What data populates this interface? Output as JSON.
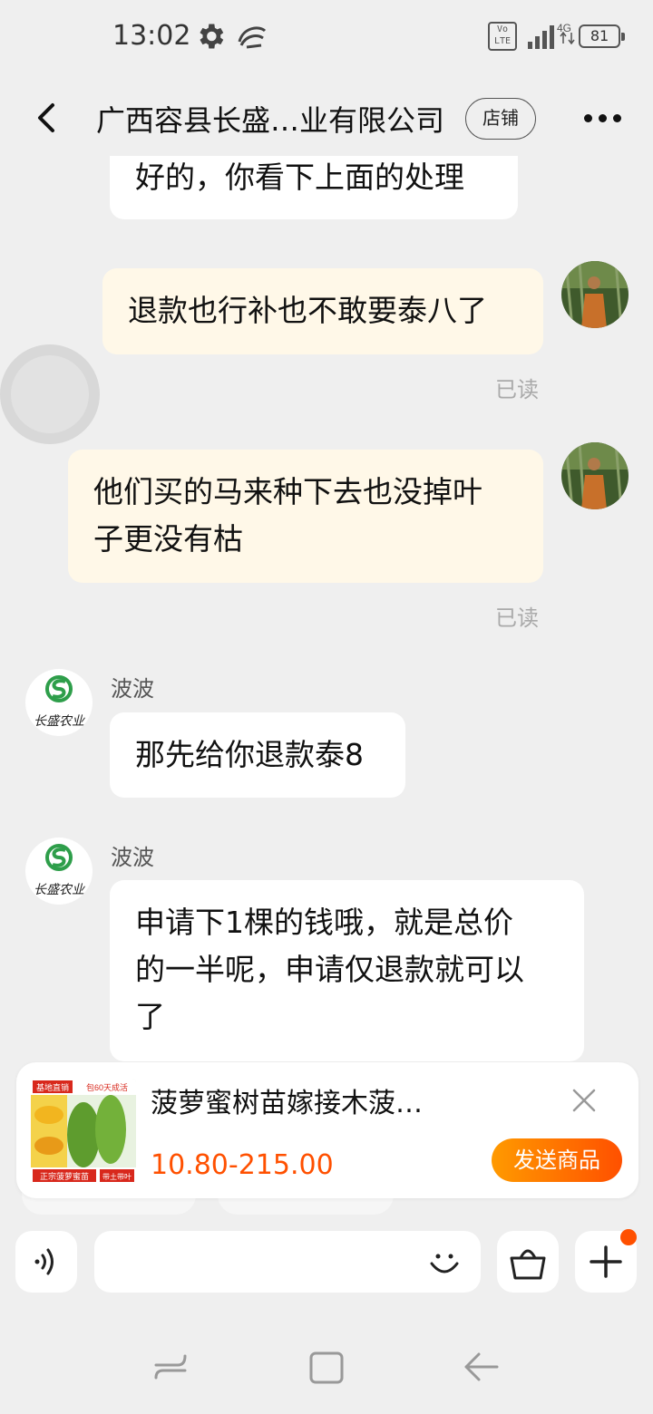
{
  "status_bar": {
    "time": "13:02",
    "network": "4G",
    "volte": "Vo LTE",
    "battery": "81",
    "icons": [
      "gear-icon",
      "app-notification-icon",
      "signal-icon",
      "battery-icon"
    ]
  },
  "header": {
    "title": "广西容县长盛…业有限公司",
    "shop_button": "店铺",
    "icons": [
      "back-icon",
      "more-icon"
    ]
  },
  "messages": {
    "m1": {
      "side": "received",
      "lines": [
        "好的，你看下上面的处理"
      ]
    },
    "m2": {
      "side": "sent",
      "lines": [
        "退款也行补也不敢要泰八了"
      ],
      "status": "已读"
    },
    "m3": {
      "side": "sent",
      "lines": [
        "他们买的马来种下去也没掉叶",
        "子更没有枯"
      ],
      "status": "已读"
    },
    "m4": {
      "side": "received",
      "sender": "波波",
      "lines": [
        "那先给你退款泰8"
      ]
    },
    "m5": {
      "side": "received",
      "sender": "波波",
      "lines": [
        "申请下1棵的钱哦，就是总价",
        "的一半呢，申请仅退款就可以",
        "了"
      ]
    }
  },
  "shop_avatar_text": "长盛农业",
  "product": {
    "name": "菠萝蜜树苗嫁接木菠…",
    "price": "10.80-215.00",
    "send_button": "发送商品",
    "thumb_tags": {
      "top_left": "基地直销",
      "top_right": "包60天成活",
      "bottom_left": "正宗菠萝蜜苗",
      "bottom_right": "带土带叶"
    }
  },
  "input": {
    "placeholder": "",
    "icons": [
      "voice-icon",
      "emoji-icon",
      "shopping-bag-icon",
      "plus-icon"
    ]
  },
  "colors": {
    "accent": "#ff5000",
    "sent_bubble": "#fff8e8",
    "received_bubble": "#ffffff",
    "background": "#efefef"
  }
}
